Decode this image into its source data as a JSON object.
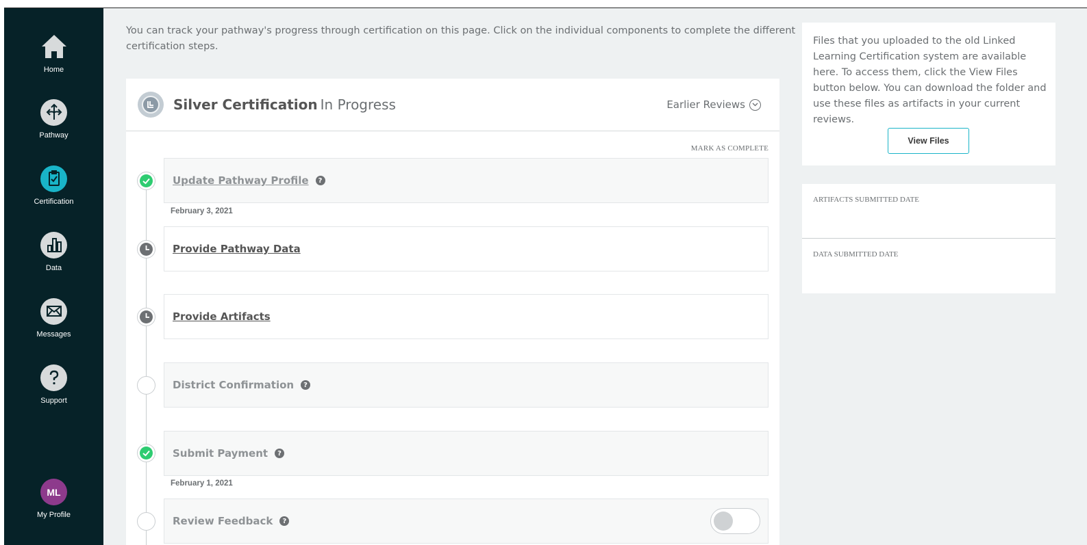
{
  "sidebar": {
    "items": [
      {
        "label": "Home",
        "icon": "home-icon"
      },
      {
        "label": "Pathway",
        "icon": "pathway-icon"
      },
      {
        "label": "Certification",
        "icon": "certification-icon",
        "active": true
      },
      {
        "label": "Data",
        "icon": "data-icon"
      },
      {
        "label": "Messages",
        "icon": "messages-icon"
      },
      {
        "label": "Support",
        "icon": "support-icon"
      }
    ],
    "profile": {
      "initials": "ML",
      "label": "My Profile"
    }
  },
  "main": {
    "intro": "You can track your pathway's progress through certification on this page. Click on the individual components to complete the different certification steps.",
    "certification": {
      "title": "Silver Certification",
      "status": "In Progress",
      "earlier_reviews": "Earlier Reviews",
      "mark_complete": "MARK AS COMPLETE"
    },
    "steps": [
      {
        "label": "Update Pathway Profile",
        "status": "complete",
        "date": "February 3, 2021",
        "help": "?"
      },
      {
        "label": "Provide Pathway Data",
        "status": "pending"
      },
      {
        "label": "Provide Artifacts",
        "status": "pending"
      },
      {
        "label": "District Confirmation",
        "status": "not-started",
        "help": "?"
      },
      {
        "label": "Submit Payment",
        "status": "complete",
        "date": "February 1, 2021",
        "help": "?"
      },
      {
        "label": "Review Feedback",
        "status": "not-started",
        "help": "?"
      }
    ]
  },
  "right": {
    "files_text": "Files that you uploaded to the old Linked Learning Certification system are available here. To access them, click the View Files button below. You can download the folder and use these files as artifacts in your current reviews.",
    "view_files": "View Files",
    "artifacts_submitted_label": "ARTIFACTS SUBMITTED DATE",
    "data_submitted_label": "DATA SUBMITTED DATE"
  },
  "colors": {
    "sidebar_bg": "#062228",
    "accent": "#19b4c8",
    "complete": "#2ecc71",
    "avatar": "#8d3a8c"
  }
}
